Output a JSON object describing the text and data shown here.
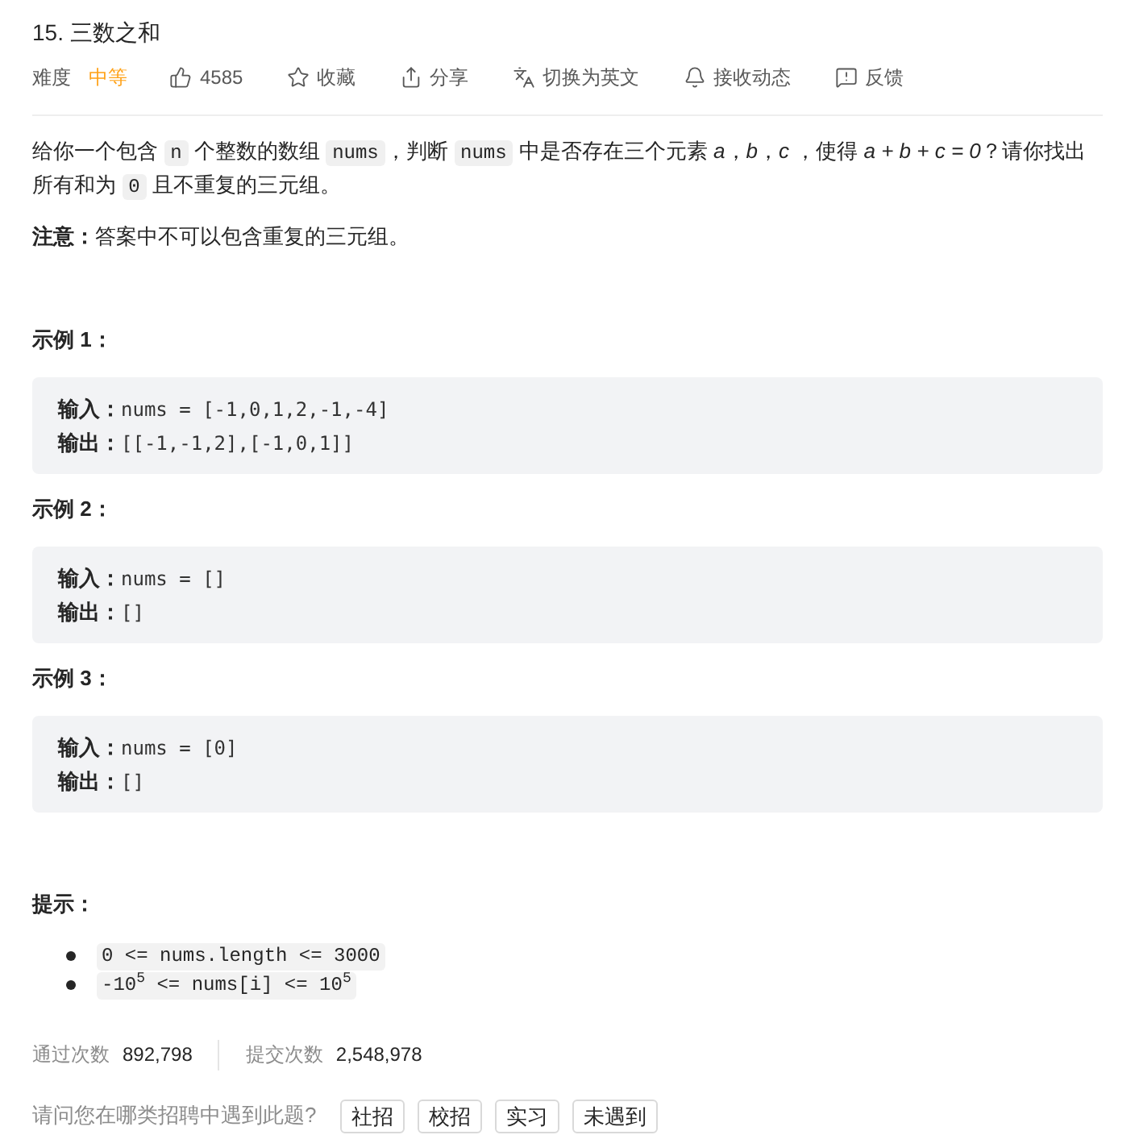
{
  "problem": {
    "title": "15. 三数之和"
  },
  "meta": {
    "difficulty_label": "难度",
    "difficulty": "中等",
    "actions": [
      {
        "kind": "like",
        "label": "4585"
      },
      {
        "kind": "star",
        "label": "收藏"
      },
      {
        "kind": "share",
        "label": "分享"
      },
      {
        "kind": "translate",
        "label": "切换为英文"
      },
      {
        "kind": "bell",
        "label": "接收动态"
      },
      {
        "kind": "feedback",
        "label": "反馈"
      }
    ]
  },
  "description": [
    {
      "kind": "text",
      "text": "给你一个包含 "
    },
    {
      "kind": "code",
      "text": "n"
    },
    {
      "kind": "text",
      "text": " 个整数的数组 "
    },
    {
      "kind": "code",
      "text": "nums"
    },
    {
      "kind": "text",
      "text": "，判断 "
    },
    {
      "kind": "code",
      "text": "nums"
    },
    {
      "kind": "text",
      "text": " 中是否存在三个元素 "
    },
    {
      "kind": "math",
      "text": "a"
    },
    {
      "kind": "text",
      "text": "，"
    },
    {
      "kind": "math",
      "text": "b"
    },
    {
      "kind": "text",
      "text": "，"
    },
    {
      "kind": "math",
      "text": "c"
    },
    {
      "kind": "text",
      "text": " ，使得 "
    },
    {
      "kind": "math",
      "text": "a + b + c = 0"
    },
    {
      "kind": "text",
      "text": "？请你找出所有和为 "
    },
    {
      "kind": "code",
      "text": "0"
    },
    {
      "kind": "text",
      "text": " 且不重复的三元组。"
    }
  ],
  "note": "**注意：**答案中不可以包含重复的三元组。",
  "examples": [
    {
      "title": "示例 1：",
      "lines": [
        {
          "label": "输入：",
          "value": "nums = [-1,0,1,2,-1,-4]"
        },
        {
          "label": "输出：",
          "value": "[[-1,-1,2],[-1,0,1]]"
        }
      ]
    },
    {
      "title": "示例 2：",
      "lines": [
        {
          "label": "输入：",
          "value": "nums = []"
        },
        {
          "label": "输出：",
          "value": "[]"
        }
      ]
    },
    {
      "title": "示例 3：",
      "lines": [
        {
          "label": "输入：",
          "value": "nums = [0]"
        },
        {
          "label": "输出：",
          "value": "[]"
        }
      ]
    }
  ],
  "hints": {
    "title": "提示：",
    "items": [
      "0 <= nums.length <= 3000",
      "-10$^{5}$ <= nums[i] <= 10$^{5}$"
    ]
  },
  "stats": [
    {
      "label": "通过次数",
      "value": "892,798"
    },
    {
      "label": "提交次数",
      "value": "2,548,978"
    }
  ],
  "survey": {
    "question": "请问您在哪类招聘中遇到此题?",
    "options": [
      "社招",
      "校招",
      "实习",
      "未遇到"
    ]
  }
}
